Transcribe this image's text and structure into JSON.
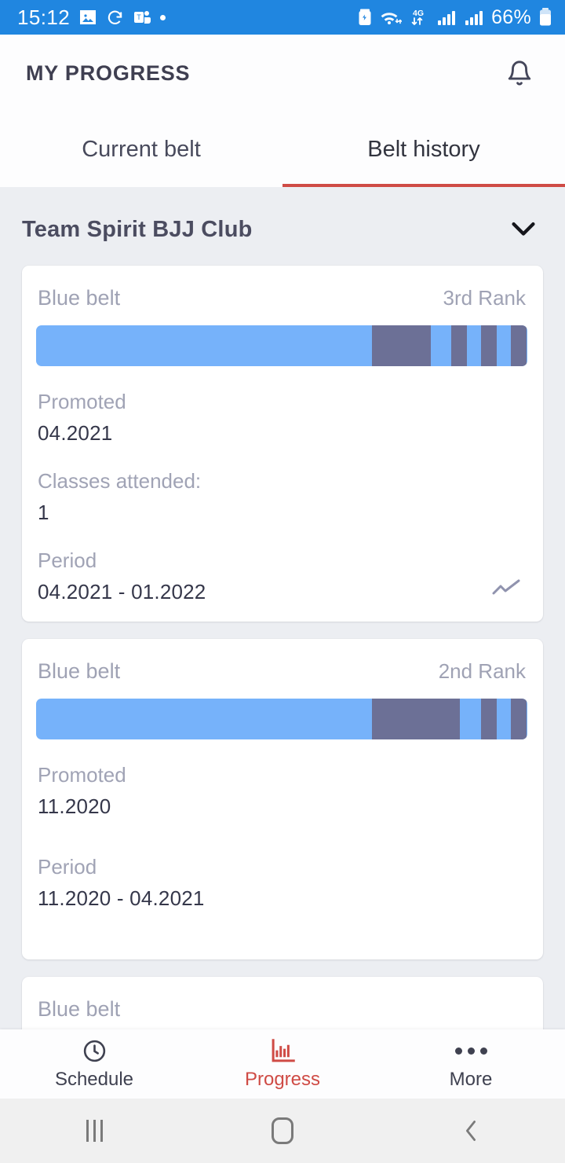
{
  "status_bar": {
    "time": "15:12",
    "battery_percent": "66%",
    "network_type": "4G",
    "icons": [
      "image-icon",
      "sync-icon",
      "teams-icon",
      "dot-icon",
      "battery-saver-icon",
      "wifi-icon",
      "mobile-data-icon",
      "signal-icon-1",
      "signal-icon-2",
      "battery-icon"
    ]
  },
  "app_bar": {
    "title": "MY PROGRESS",
    "notification_icon": "bell-icon"
  },
  "tabs": {
    "items": [
      {
        "label": "Current belt",
        "active": false
      },
      {
        "label": "Belt history",
        "active": true
      }
    ]
  },
  "club": {
    "name": "Team Spirit BJJ Club",
    "expand_icon": "chevron-down-icon"
  },
  "colors": {
    "accent_red": "#cf4b45",
    "belt_blue": "#76b2fa",
    "belt_bar_dark": "#6c7096",
    "status_bar_blue": "#2086e0",
    "muted_text": "#9fa2b4",
    "value_text": "#35374a",
    "page_bg": "#eceef2"
  },
  "cards": [
    {
      "belt": "Blue belt",
      "rank": "3rd Rank",
      "promoted_label": "Promoted",
      "promoted_value": "04.2021",
      "classes_label": "Classes attended:",
      "classes_value": "1",
      "period_label": "Period",
      "period_value": "04.2021 - 01.2022",
      "has_trend_icon": true,
      "trend_icon": "trend-line-icon",
      "bar": {
        "blue_end_pct": 68.3,
        "segments": [
          {
            "left_pct": 68.3,
            "width_pct": 12.1
          },
          {
            "left_pct": 84.5,
            "width_pct": 3.2
          },
          {
            "left_pct": 90.6,
            "width_pct": 3.2
          },
          {
            "left_pct": 96.7,
            "width_pct": 3.2
          }
        ]
      }
    },
    {
      "belt": "Blue belt",
      "rank": "2nd Rank",
      "promoted_label": "Promoted",
      "promoted_value": "11.2020",
      "classes_label": null,
      "classes_value": null,
      "period_label": "Period",
      "period_value": "11.2020 - 04.2021",
      "has_trend_icon": false,
      "trend_icon": null,
      "bar": {
        "blue_end_pct": 68.3,
        "segments": [
          {
            "left_pct": 68.3,
            "width_pct": 18.0
          },
          {
            "left_pct": 90.6,
            "width_pct": 3.2
          },
          {
            "left_pct": 96.7,
            "width_pct": 3.2
          }
        ]
      }
    },
    {
      "belt": "Blue belt",
      "rank": null,
      "promoted_label": null,
      "promoted_value": null,
      "classes_label": null,
      "classes_value": null,
      "period_label": null,
      "period_value": null,
      "has_trend_icon": false,
      "trend_icon": null,
      "bar": {
        "blue_end_pct": 68.3,
        "segments": [
          {
            "left_pct": 68.3,
            "width_pct": 28.4
          }
        ]
      }
    }
  ],
  "bottom_nav": {
    "items": [
      {
        "label": "Schedule",
        "icon": "clock-icon",
        "active": false
      },
      {
        "label": "Progress",
        "icon": "bar-chart-icon",
        "active": true
      },
      {
        "label": "More",
        "icon": "more-dots-icon",
        "active": false
      }
    ]
  },
  "system_nav": {
    "items": [
      {
        "name": "recents-button",
        "icon": "recents-icon"
      },
      {
        "name": "home-button",
        "icon": "home-icon"
      },
      {
        "name": "back-button",
        "icon": "back-chevron-icon"
      }
    ]
  }
}
